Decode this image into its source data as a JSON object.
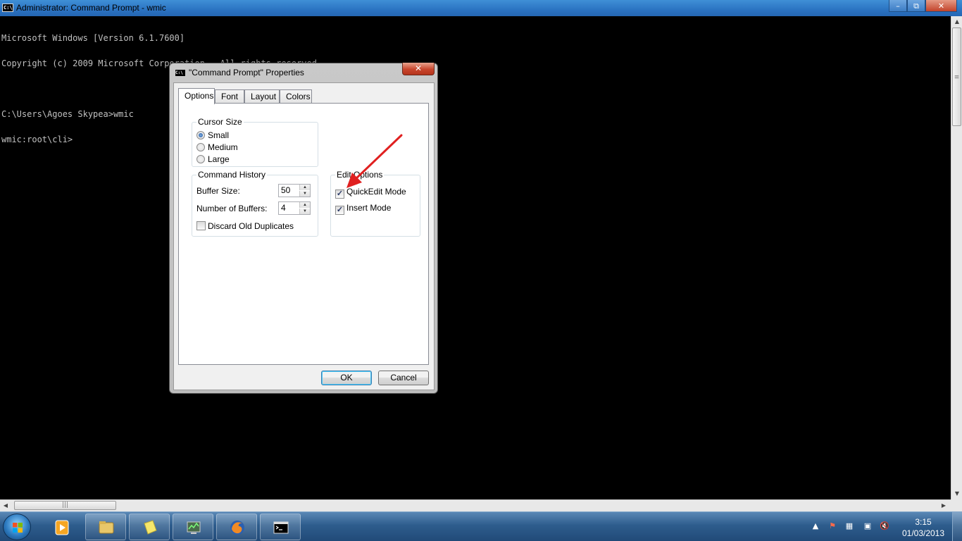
{
  "window": {
    "title": "Administrator: Command Prompt - wmic",
    "minimize_glyph": "–",
    "maximize_glyph": "⧉",
    "close_glyph": "✕"
  },
  "console": {
    "lines": [
      "Microsoft Windows [Version 6.1.7600]",
      "Copyright (c) 2009 Microsoft Corporation.  All rights reserved.",
      "",
      "C:\\Users\\Agoes Skypea>wmic",
      "wmic:root\\cli>"
    ]
  },
  "dialog": {
    "title": "\"Command Prompt\" Properties",
    "close_glyph": "✕",
    "tabs": [
      {
        "label": "Options",
        "active": true
      },
      {
        "label": "Font",
        "active": false
      },
      {
        "label": "Layout",
        "active": false
      },
      {
        "label": "Colors",
        "active": false
      }
    ],
    "cursor_size": {
      "legend": "Cursor Size",
      "options": [
        {
          "label": "Small",
          "selected": true
        },
        {
          "label": "Medium",
          "selected": false
        },
        {
          "label": "Large",
          "selected": false
        }
      ]
    },
    "command_history": {
      "legend": "Command History",
      "buffer_size_label": "Buffer Size:",
      "buffer_size_value": "50",
      "num_buffers_label": "Number of Buffers:",
      "num_buffers_value": "4",
      "discard_label": "Discard Old Duplicates",
      "discard_checked": false
    },
    "edit_options": {
      "legend": "Edit Options",
      "quickedit_label": "QuickEdit Mode",
      "quickedit_checked": true,
      "insert_label": "Insert Mode",
      "insert_checked": true
    },
    "ok_label": "OK",
    "cancel_label": "Cancel"
  },
  "annotation": {
    "arrow_color": "#e02020",
    "target": "QuickEdit Mode checkbox"
  },
  "taskbar": {
    "items": [
      "start-orb",
      "windows-media-player-icon",
      "windows-explorer-icon",
      "sticky-notes-icon",
      "network-monitor-icon",
      "firefox-icon",
      "command-prompt-icon"
    ],
    "clock_time": "3:15",
    "clock_date": "01/03/2013"
  },
  "colors": {
    "console_bg": "#000000",
    "console_text": "#c0c0c0",
    "titlebar": "#2b73c2",
    "close_button": "#c8462d",
    "taskbar": "#2e5d8d"
  }
}
